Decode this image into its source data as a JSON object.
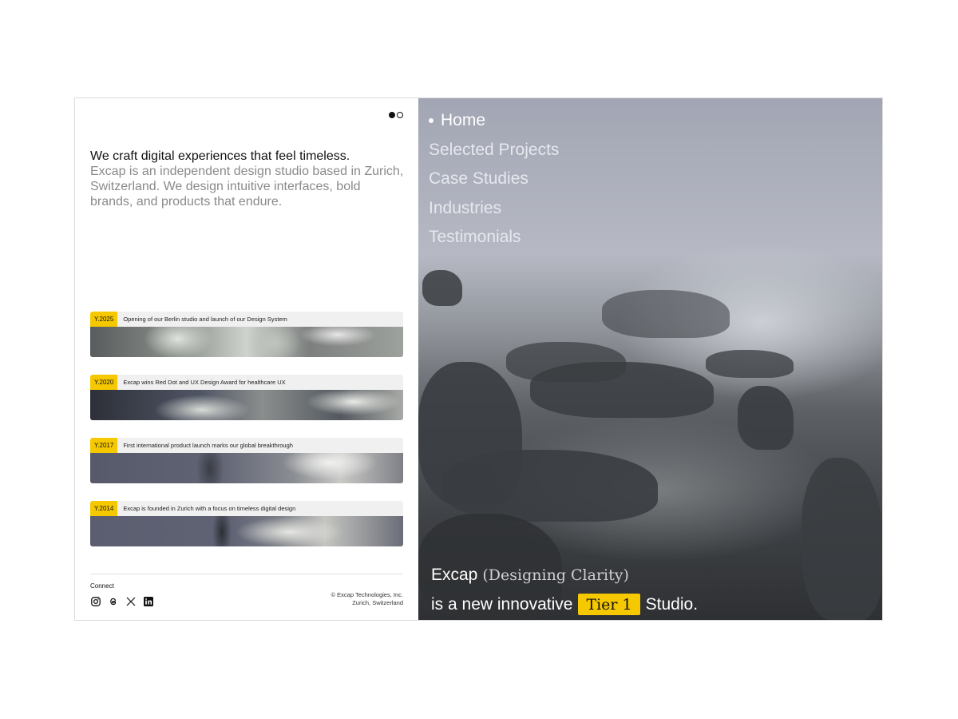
{
  "pager": {
    "pages": 2,
    "current": 1
  },
  "intro": {
    "headline": "We craft digital experiences that feel timeless.",
    "body": "Excap is an independent design studio based in Zurich, Switzerland. We design intuitive interfaces, bold brands, and products that endure."
  },
  "timeline": [
    {
      "year": "Y.2025",
      "text": "Opening of our Berlin studio and launch of our Design System"
    },
    {
      "year": "Y.2020",
      "text": "Excap wins Red Dot and UX Design Award for healthcare UX"
    },
    {
      "year": "Y.2017",
      "text": "First international product launch marks our global breakthrough"
    },
    {
      "year": "Y.2014",
      "text": "Excap is founded in Zurich with a focus on timeless digital design"
    }
  ],
  "footer": {
    "connect_label": "Connect",
    "socials": [
      "instagram-icon",
      "threads-icon",
      "x-icon",
      "linkedin-icon"
    ],
    "copyright": "© Excap Technologies, Inc.",
    "location": "Zurich, Switzerland"
  },
  "nav": {
    "items": [
      "Home",
      "Selected Projects",
      "Case Studies",
      "Industries",
      "Testimonials"
    ],
    "active": "Home"
  },
  "tagline": {
    "brand": "Excap",
    "subtitle": "(Designing Clarity)",
    "prefix": "is a new innovative",
    "highlight": "Tier 1",
    "suffix": "Studio."
  },
  "colors": {
    "accent": "#f5c800",
    "text": "#111111",
    "muted": "#8a8a8a"
  }
}
